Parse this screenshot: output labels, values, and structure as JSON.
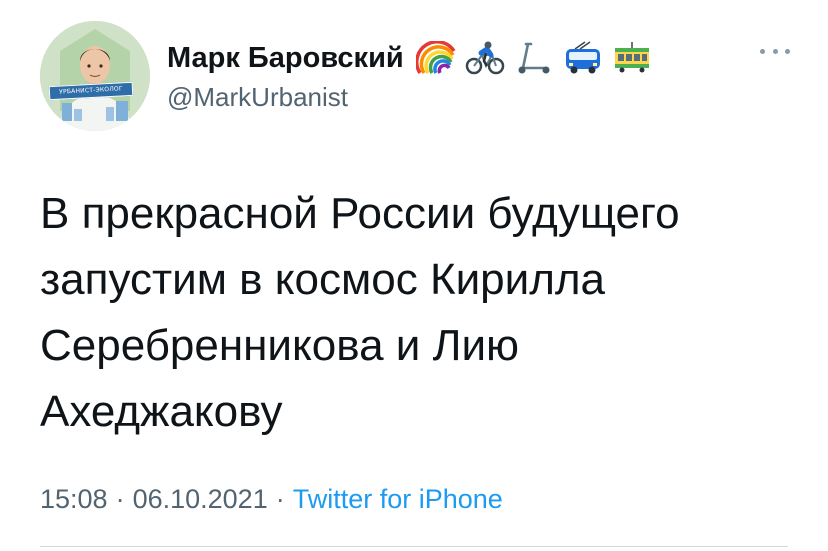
{
  "author": {
    "display_name": "Марк Баровский",
    "handle": "@MarkUrbanist",
    "avatar_badge": "УРБАНИСТ-ЭКОЛОГ",
    "name_emojis": [
      "rainbow-emoji",
      "cyclist-emoji",
      "kick-scooter-emoji",
      "trolleybus-emoji",
      "tram-emoji"
    ]
  },
  "tweet": {
    "lines": [
      "В прекрасной России будущего",
      "запустим в космос Кирилла",
      "Серебренникова и Лию",
      "Ахеджакову"
    ]
  },
  "meta": {
    "time": "15:08",
    "date": "06.10.2021",
    "separator": "·",
    "source": "Twitter for iPhone"
  },
  "colors": {
    "text": "#0f1419",
    "secondary": "#536471",
    "link": "#1d9bf0",
    "divider": "#cfd9de"
  }
}
